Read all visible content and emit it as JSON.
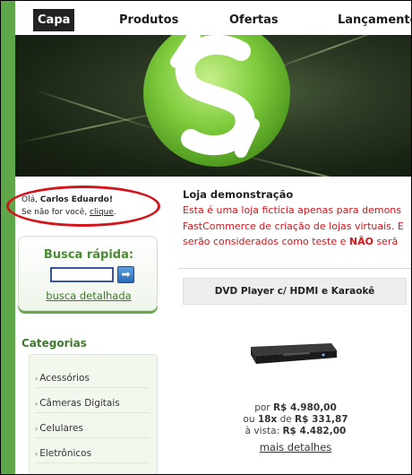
{
  "nav": {
    "items": [
      "Capa",
      "Produtos",
      "Ofertas",
      "Lançamentos"
    ],
    "active": "Capa"
  },
  "greeting": {
    "hello": "Olá,",
    "name": "Carlos Eduardo!",
    "not_you": "Se não for você,",
    "link": "clique",
    "end": "."
  },
  "search": {
    "title": "Busca rápida:",
    "placeholder": "",
    "button_icon": "arrow-right-icon",
    "detailed_link": "busca detalhada"
  },
  "categories": {
    "title": "Categorias",
    "items": [
      "Acessórios",
      "Câmeras Digitais",
      "Celulares",
      "Eletrônicos"
    ]
  },
  "main": {
    "title": "Loja demonstração",
    "desc_line1": "Esta é uma loja fictícia apenas para demons",
    "desc_line2": "FastCommerce de criação de lojas virtuais. E",
    "desc_line3_a": "serão considerados como teste e",
    "desc_line3_bold": "NÃO",
    "desc_line3_b": "serã"
  },
  "product": {
    "name": "DVD Player c/ HDMI e Karaokê",
    "price_prefix": "por",
    "price": "R$ 4.980,00",
    "installments_prefix": "ou",
    "installments_count": "18x",
    "installments_mid": "de",
    "installment_value": "R$ 331,87",
    "cash_prefix": "à vista:",
    "cash_price": "R$ 4.482,00",
    "more_link": "mais detalhes"
  },
  "colors": {
    "accent_green": "#5fa84a",
    "highlight_red": "#d3141c",
    "text_red": "#d4141b"
  }
}
